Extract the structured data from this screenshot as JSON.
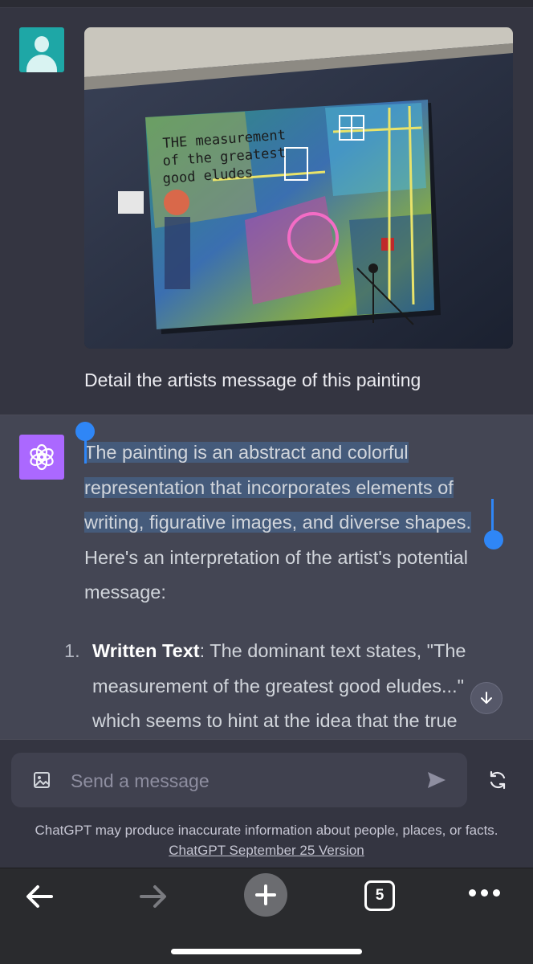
{
  "user_message": {
    "text": "Detail the artists message of this painting",
    "avatar_icon": "user-avatar-icon",
    "image": {
      "description_icon": "painting-photo",
      "painted_text_lines": [
        "THE measurement",
        "of the greatest",
        "good eludes"
      ]
    }
  },
  "assistant_message": {
    "avatar_icon": "openai-logo-icon",
    "avatar_color": "#ab68ff",
    "paragraph_selected": "The painting is an abstract and colorful representation that incorporates elements of writing, figurative images, and diverse shapes.",
    "paragraph_rest": "Here's an interpretation of the artist's potential message:",
    "list": [
      {
        "number": "1.",
        "title": "Written Text",
        "text": ": The dominant text states, \"The measurement of the greatest good eludes...\" which seems to hint at the idea that the true"
      }
    ]
  },
  "composer": {
    "placeholder": "Send a message",
    "image_button_icon": "image-icon",
    "send_icon": "send-icon",
    "regenerate_icon": "refresh-icon"
  },
  "disclaimer": {
    "text": "ChatGPT may produce inaccurate information about people, places, or facts.",
    "version_link": "ChatGPT September 25 Version"
  },
  "browser_toolbar": {
    "tab_count": "5",
    "back_icon": "arrow-left-icon",
    "forward_icon": "arrow-right-icon",
    "new_tab_icon": "plus-icon",
    "more_icon": "more-dots-icon"
  },
  "colors": {
    "background": "#343541",
    "assistant_background": "#444654",
    "selection_highlight": "#455b7b",
    "selection_handle": "#2f86f6",
    "user_avatar": "#1ea7a6"
  }
}
